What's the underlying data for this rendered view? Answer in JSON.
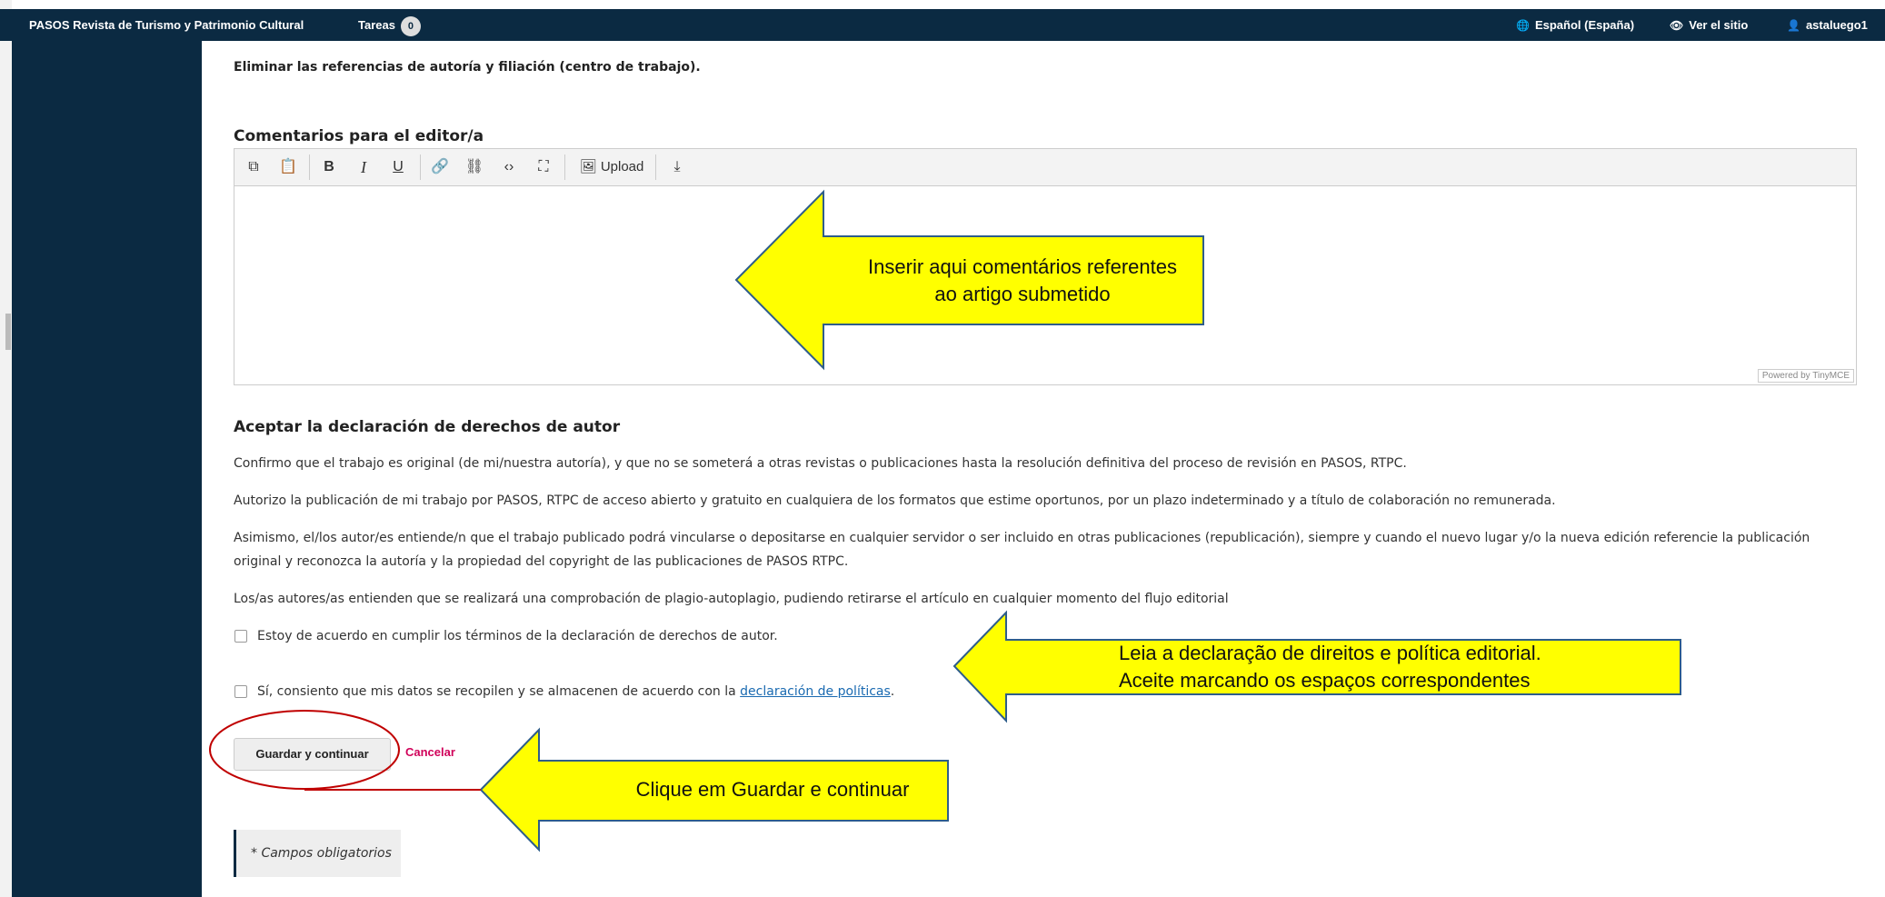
{
  "topbar": {
    "journal_title": "PASOS Revista de Turismo y Patrimonio Cultural",
    "tasks_label": "Tareas",
    "tasks_count": "0",
    "language": "Español (España)",
    "view_site": "Ver el sitio",
    "user": "astaluego1"
  },
  "form": {
    "remove_refs_text": "Eliminar las referencias de autoría y filiación (centro de trabajo).",
    "comments_label": "Comentarios para el editor/a",
    "upload_label": "Upload",
    "powered_by": "Powered by TinyMCE",
    "copyright_heading": "Aceptar la declaración de derechos de autor",
    "para1": "Confirmo que el trabajo es original (de mi/nuestra autoría), y que no se someterá a otras revistas o publicaciones hasta la resolución definitiva del proceso de revisión en PASOS, RTPC.",
    "para2": "Autorizo la publicación de mi trabajo por PASOS, RTPC de acceso abierto y gratuito en cualquiera de los formatos que estime oportunos, por un plazo indeterminado y a título de colaboración no remunerada.",
    "para3_line1": "Asimismo, el/los autor/es entiende/n que el trabajo publicado podrá vincularse o depositarse en cualquier servidor o ser incluido en otras publicaciones (republicación),  siempre y cuando el nuevo lugar y/o la nueva edición referencie la publicación",
    "para3_line2": "original y reconozca la autoría y la propiedad del copyright de las publicaciones de PASOS RTPC.",
    "para4": "Los/as autores/as entienden que se realizará una comprobación de plagio-autoplagio, pudiendo retirarse el artículo en cualquier momento del flujo editorial",
    "checkbox1_label": "Estoy de acuerdo en cumplir los términos de la declaración de derechos de autor.",
    "checkbox2_prefix": "Sí, consiento que mis datos se recopilen y se almacenen de acuerdo con la ",
    "checkbox2_link": "declaración de políticas",
    "checkbox2_suffix": ".",
    "save_button": "Guardar y continuar",
    "cancel_link": "Cancelar",
    "required_note": "* Campos obligatorios"
  },
  "annotations": {
    "a1_line1": "Inserir aqui comentários referentes",
    "a1_line2": "ao artigo submetido",
    "a2_line1": "Leia a declaração de direitos e política editorial.",
    "a2_line2": "Aceite marcando os espaços correspondentes",
    "a3": "Clique em Guardar e continuar"
  },
  "colors": {
    "topbar": "#0b2a42",
    "cancel": "#d00059",
    "annotation_fill": "#ffff00",
    "annotation_stroke": "#2e5d8a",
    "circle": "#c00000"
  }
}
